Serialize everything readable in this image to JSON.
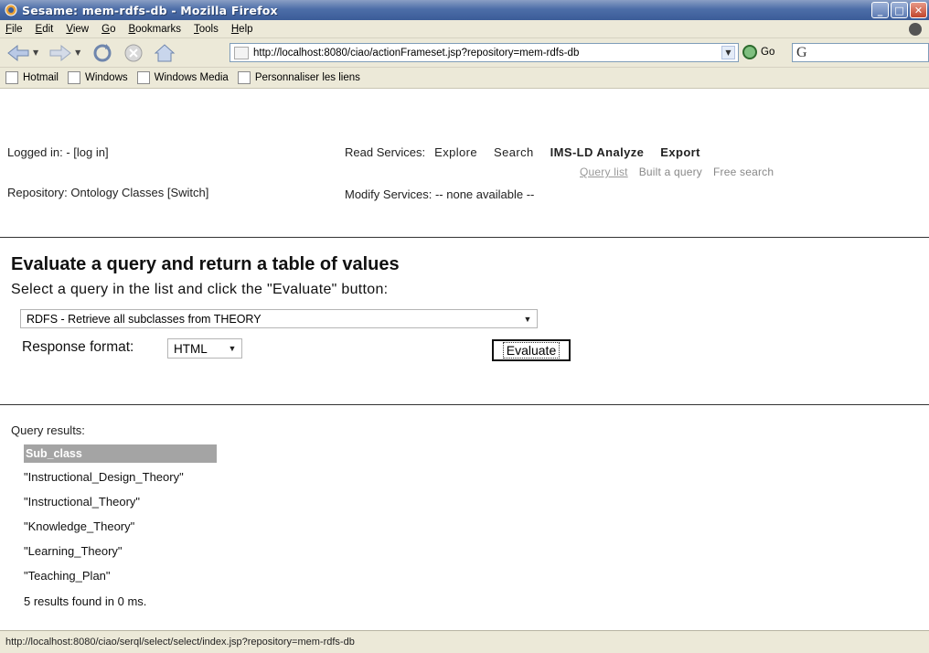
{
  "window": {
    "title": "Sesame: mem-rdfs-db - Mozilla Firefox",
    "icon": "firefox-icon"
  },
  "menu": [
    "File",
    "Edit",
    "View",
    "Go",
    "Bookmarks",
    "Tools",
    "Help"
  ],
  "navigation": {
    "url": "http://localhost:8080/ciao/actionFrameset.jsp?repository=mem-rdfs-db",
    "go_label": "Go",
    "search_engine_icon": "G"
  },
  "bookmarks": [
    "Hotmail",
    "Windows",
    "Windows Media",
    "Personnaliser les liens"
  ],
  "header": {
    "login_text": "Logged in: - [log in]",
    "repository_text": "Repository: Ontology Classes [Switch]",
    "read_services_label": "Read Services:",
    "read_services": [
      "Explore",
      "Search",
      "IMS-LD Analyze",
      "Export"
    ],
    "query_sublinks": [
      "Query list",
      "Built a query",
      "Free search"
    ],
    "modify_services": "Modify Services: -- none available --"
  },
  "query_form": {
    "heading": "Evaluate a query and return a table of values",
    "instruction": "Select a query in the list and click the \"Evaluate\" button:",
    "selected_query": "RDFS - Retrieve all subclasses from THEORY",
    "response_format_label": "Response format:",
    "response_format_value": "HTML",
    "evaluate_label": "Evaluate"
  },
  "results": {
    "title": "Query results:",
    "column_header": "Sub_class",
    "rows": [
      "\"Instructional_Design_Theory\"",
      "\"Instructional_Theory\"",
      "\"Knowledge_Theory\"",
      "\"Learning_Theory\"",
      "\"Teaching_Plan\""
    ],
    "summary": "5 results found in 0 ms."
  },
  "status_bar": {
    "text": "http://localhost:8080/ciao/serql/select/select/index.jsp?repository=mem-rdfs-db"
  },
  "colors": {
    "titlebar": "#3b5c98",
    "chrome": "#ece9d8",
    "result_header": "#a4a4a4"
  }
}
